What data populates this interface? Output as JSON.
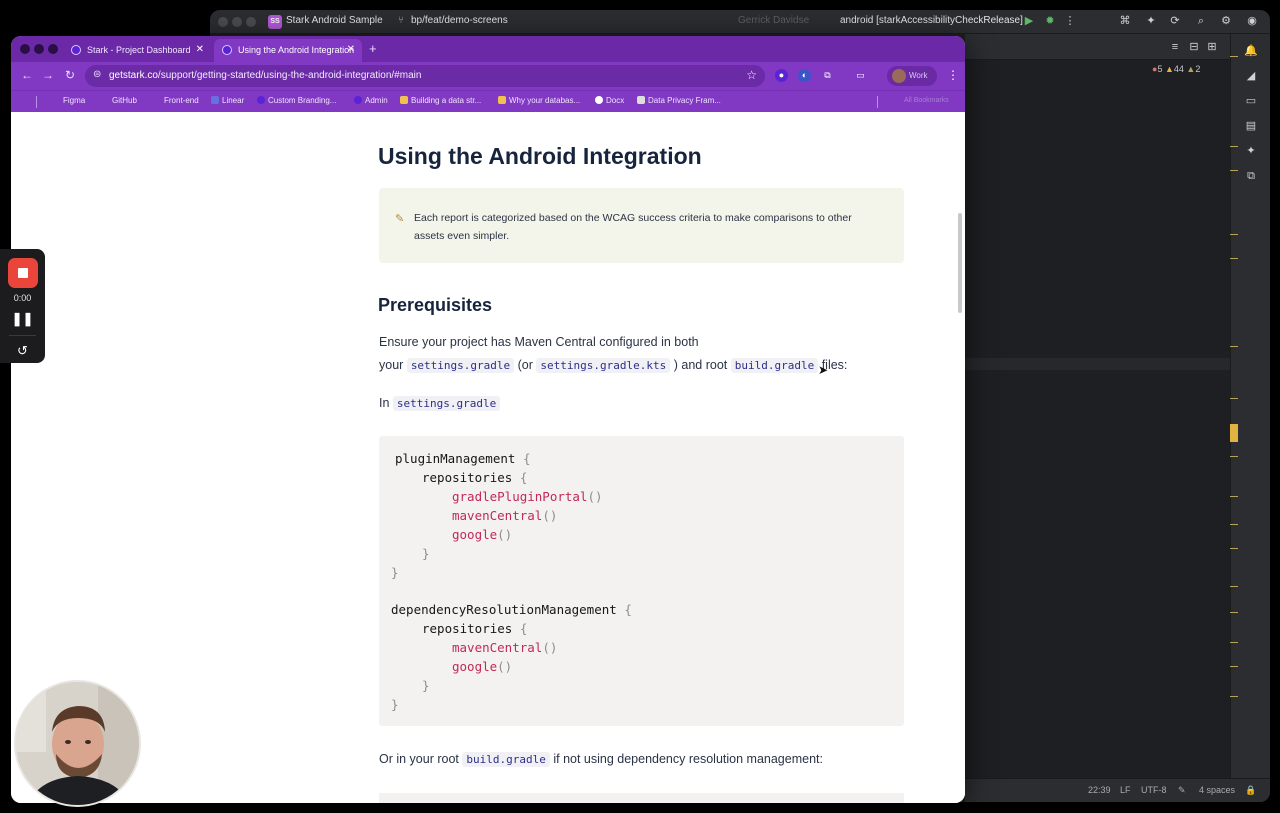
{
  "ide": {
    "project_name": "Stark Android Sample",
    "project_badge": "SS",
    "branch": "bp/feat/demo-screens",
    "user": "Gerrick Davidse",
    "run_config": "android [starkAccessibilityCheckRelease]",
    "inspections": {
      "errors": "5",
      "warnings": "44",
      "weak": "2"
    },
    "status": {
      "position": "22:39",
      "line_sep": "LF",
      "encoding": "UTF-8",
      "indent": "4 spaces"
    }
  },
  "browser": {
    "tabs": [
      {
        "title": "Stark - Project Dashboard"
      },
      {
        "title": "Using the Android Integration"
      }
    ],
    "url_host": "getstark.co",
    "url_path": "/support/getting-started/using-the-android-integration/#main",
    "profile_label": "Work",
    "bookmarks": [
      "Figma",
      "GitHub",
      "Front-end",
      "Linear",
      "Custom Branding...",
      "Admin",
      "Building a data str...",
      "Why your databas...",
      "Docx",
      "Data Privacy Fram..."
    ],
    "all_bookmarks": "All Bookmarks"
  },
  "page": {
    "title": "Using the Android Integration",
    "callout": "Each report is categorized based on the WCAG success criteria to make comparisons to other assets even simpler.",
    "prereq_heading": "Prerequisites",
    "para1_line1": "Ensure your project has Maven Central configured in both",
    "para1_your": "your",
    "para1_code1": "settings.gradle",
    "para1_or": "(or",
    "para1_code2": "settings.gradle.kts",
    "para1_and": ") and root",
    "para1_code3": "build.gradle",
    "para1_files": "files:",
    "in_label": "In",
    "in_code": "settings.gradle",
    "code": {
      "l1": "pluginManagement",
      "l2": "repositories",
      "l3": "gradlePluginPortal",
      "l4": "mavenCentral",
      "l5": "google",
      "l8": "dependencyResolutionManagement",
      "l9": "repositories",
      "l10": "mavenCentral",
      "l11": "google"
    },
    "para2_pre": "Or in your root",
    "para2_code": "build.gradle",
    "para2_post": "if not using dependency resolution management:"
  },
  "recorder": {
    "time": "0:00"
  }
}
